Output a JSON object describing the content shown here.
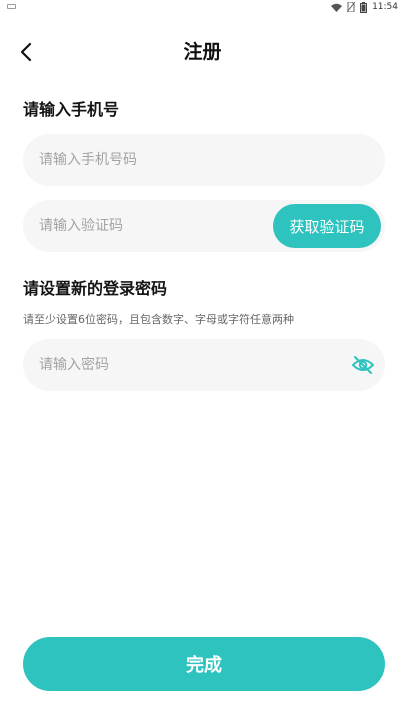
{
  "status_bar": {
    "time": "11:54"
  },
  "nav": {
    "title": "注册"
  },
  "phone_section": {
    "title": "请输入手机号",
    "phone_placeholder": "请输入手机号码",
    "phone_value": "",
    "code_placeholder": "请输入验证码",
    "code_value": "",
    "get_code_label": "获取验证码"
  },
  "password_section": {
    "title": "请设置新的登录密码",
    "hint": "请至少设置6位密码，且包含数字、字母或字符任意两种",
    "password_placeholder": "请输入密码",
    "password_value": ""
  },
  "submit_label": "完成",
  "colors": {
    "accent": "#2fc3bf",
    "field_bg": "#f6f6f6",
    "placeholder": "#a3a3a3"
  },
  "icons": {
    "back": "chevron-left-icon",
    "password_visibility": "eye-off-icon"
  }
}
